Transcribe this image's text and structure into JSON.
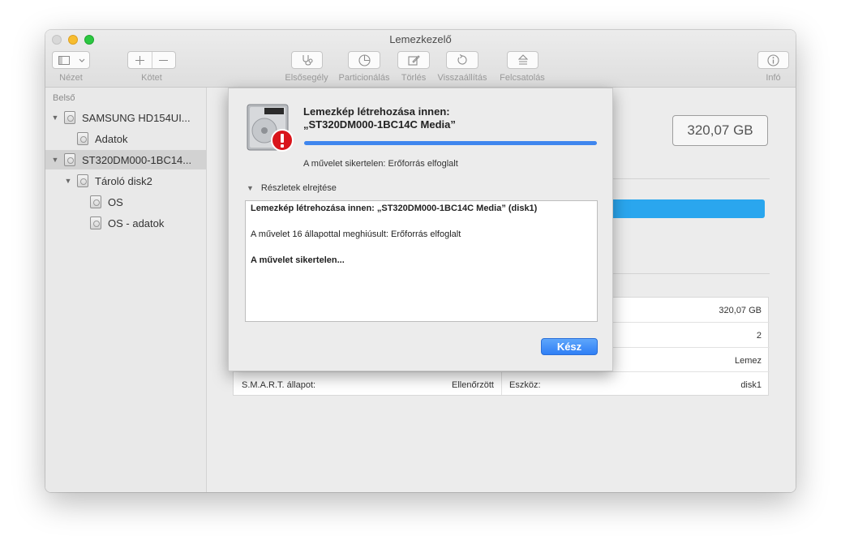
{
  "window": {
    "title": "Lemezkezelő"
  },
  "toolbar": {
    "view_label": "Nézet",
    "volume_label": "Kötet",
    "first_aid_label": "Elsősegély",
    "partition_label": "Particionálás",
    "erase_label": "Törlés",
    "restore_label": "Visszaállítás",
    "mount_label": "Felcsatolás",
    "info_label": "Infó"
  },
  "sidebar": {
    "heading": "Belső",
    "items": [
      {
        "label": "SAMSUNG HD154UI..."
      },
      {
        "label": "Adatok"
      },
      {
        "label": "ST320DM000-1BC14..."
      },
      {
        "label": "Tároló disk2"
      },
      {
        "label": "OS"
      },
      {
        "label": "OS - adatok"
      }
    ]
  },
  "main": {
    "capacity": "320,07 GB",
    "info": {
      "row1_value": "320,07 GB",
      "row2_value": "2",
      "row3_value": "Lemez",
      "smart_label": "S.M.A.R.T. állapot:",
      "smart_value": "Ellenőrzött",
      "device_label": "Eszköz:",
      "device_value": "disk1"
    }
  },
  "dialog": {
    "title_line1": "Lemezkép létrehozása innen:",
    "title_line2": "„ST320DM000-1BC14C Media”",
    "progress": 1.0,
    "status": "A művelet sikertelen: Erőforrás elfoglalt",
    "details_toggle": "Részletek elrejtése",
    "log": [
      "Lemezkép létrehozása innen: „ST320DM000-1BC14C Media” (disk1)",
      "A művelet 16 állapottal meghiúsult: Erőforrás elfoglalt",
      "A művelet sikertelen..."
    ],
    "done_label": "Kész"
  }
}
